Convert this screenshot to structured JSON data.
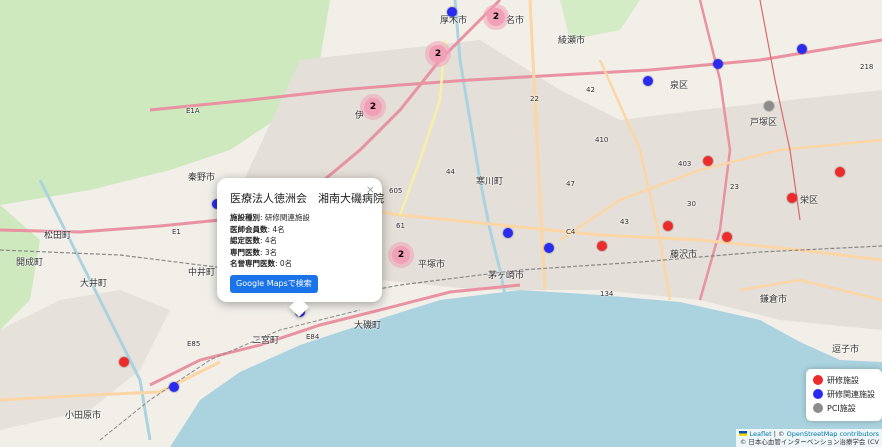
{
  "map": {
    "place_labels": [
      "厚木市",
      "名市",
      "綾瀬市",
      "伊",
      "秦野市",
      "寒川町",
      "茅ヶ崎市",
      "平塚市",
      "藤沢市",
      "鎌倉市",
      "大磯町",
      "二宮町",
      "中井町",
      "大井町",
      "小田原市",
      "松田町",
      "開成町",
      "逗子市",
      "戸塚区",
      "泉区",
      "栄区"
    ],
    "road_labels": [
      "E1A",
      "605",
      "44",
      "47",
      "43",
      "30",
      "134",
      "E84",
      "E85",
      "E1",
      "61",
      "C4",
      "22",
      "42",
      "403",
      "23",
      "218",
      "410"
    ]
  },
  "markers": [
    {
      "type": "研修関連施設",
      "color": "#2b2bf0"
    },
    {
      "type": "研修施設",
      "color": "#ee2b2b"
    },
    {
      "type": "PCI施設",
      "color": "#8c8c8c"
    }
  ],
  "clusters": [
    "2",
    "2",
    "2",
    "2"
  ],
  "popup": {
    "title": "医療法人徳洲会　湘南大磯病院",
    "close": "×",
    "rows": [
      {
        "label": "施設種別",
        "value": ": 研修関連施設"
      },
      {
        "label": "医師会員数",
        "value": ": 4名"
      },
      {
        "label": "認定医数",
        "value": ": 4名"
      },
      {
        "label": "専門医数",
        "value": ": 3名"
      },
      {
        "label": "名誉専門医数",
        "value": ": 0名"
      }
    ],
    "button": "Google Mapsで検索"
  },
  "legend": [
    {
      "label": "研修施設",
      "color": "#ee2b2b"
    },
    {
      "label": "研修関連施設",
      "color": "#2b2bf0"
    },
    {
      "label": "PCI施設",
      "color": "#8c8c8c"
    }
  ],
  "attribution": {
    "leaflet": "Leaflet",
    "sep": " | © ",
    "osm": "OpenStreetMap contributors",
    "line2": "© 日本心血管インターベンション治療学会 (CV"
  },
  "colors": {
    "sea": "#aad3df",
    "land": "#f2efe9",
    "forest": "#c8e6b4",
    "urban": "#e0dcd6",
    "motorway": "#e892a2",
    "primary": "#fcd6a4"
  }
}
